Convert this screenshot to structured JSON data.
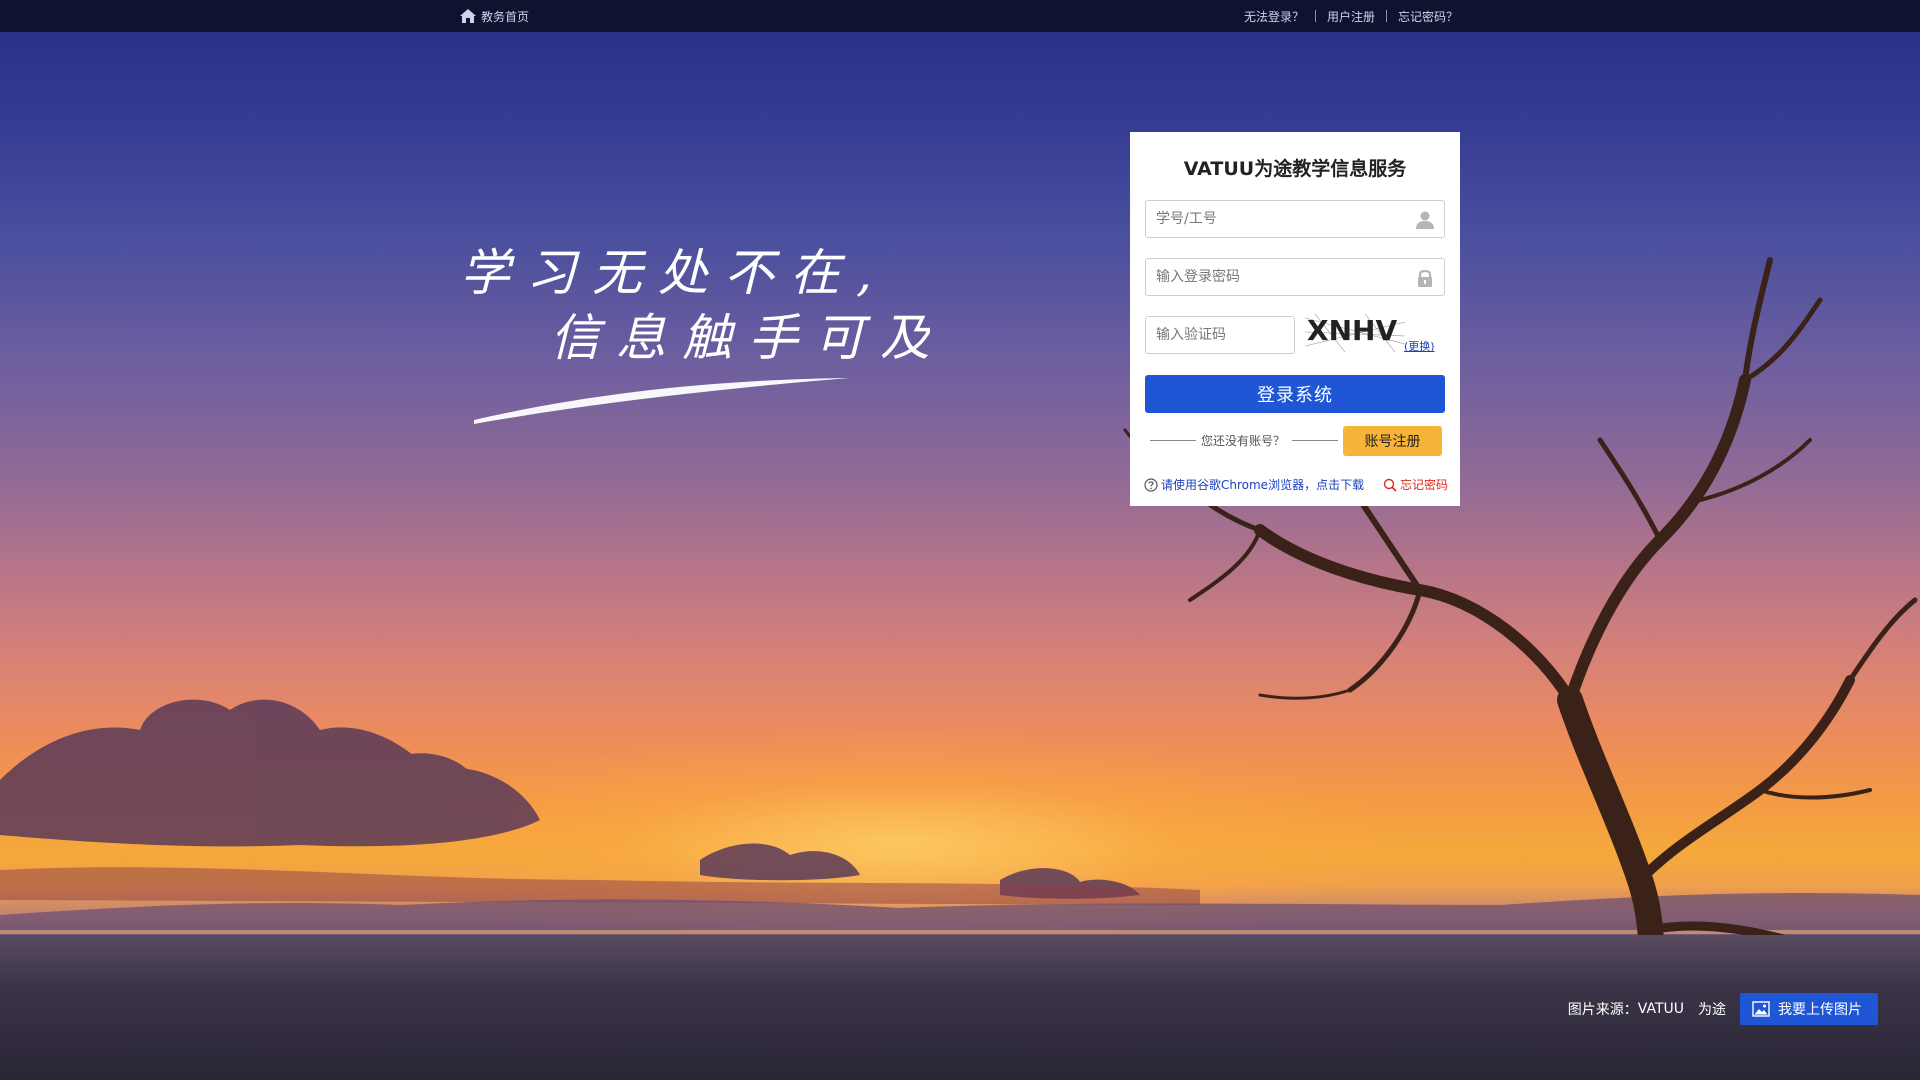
{
  "topbar": {
    "home_label": "教务首页",
    "links": [
      "无法登录？",
      "用户注册",
      "忘记密码？"
    ]
  },
  "slogan": {
    "line1": "学习无处不在,",
    "line2": "信息触手可及"
  },
  "login": {
    "title": "VATUU为途教学信息服务",
    "username_placeholder": "学号/工号",
    "password_placeholder": "输入登录密码",
    "captcha_placeholder": "输入验证码",
    "captcha_text": "XNHV",
    "refresh_label": "(更换)",
    "submit_label": "登录系统",
    "no_account_prompt": "您还没有账号？",
    "register_label": "账号注册",
    "browser_tip": "请使用谷歌Chrome浏览器，点击下载",
    "forgot_label": "忘记密码"
  },
  "credit": {
    "source_label": "图片来源：",
    "brand": "VATUU",
    "brand_sub": "为途",
    "upload_label": "我要上传图片"
  },
  "colors": {
    "primary": "#1f56d6",
    "register": "#f7b43a",
    "forgot": "#e0281e",
    "link": "#1a3fc0",
    "topbar": "#0f1330"
  }
}
